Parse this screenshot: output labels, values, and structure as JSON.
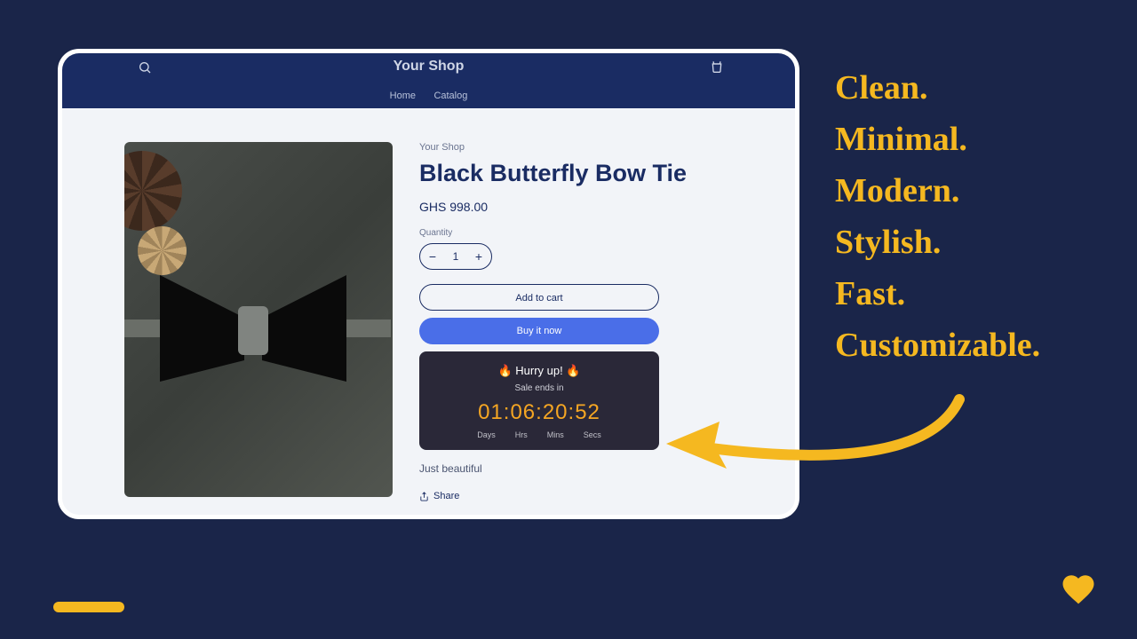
{
  "shop": {
    "title": "Your Shop",
    "nav": {
      "home": "Home",
      "catalog": "Catalog"
    }
  },
  "product": {
    "vendor": "Your Shop",
    "title": "Black Butterfly Bow Tie",
    "price": "GHS 998.00",
    "quantity_label": "Quantity",
    "quantity_value": "1",
    "add_to_cart": "Add to cart",
    "buy_now": "Buy it now",
    "description": "Just beautiful",
    "share_label": "Share"
  },
  "countdown": {
    "headline": "🔥 Hurry up! 🔥",
    "subtext": "Sale ends in",
    "days": "01",
    "hrs": "06",
    "mins": "20",
    "secs": "52",
    "label_days": "Days",
    "label_hrs": "Hrs",
    "label_mins": "Mins",
    "label_secs": "Secs"
  },
  "features": {
    "f1": "Clean.",
    "f2": "Minimal.",
    "f3": "Modern.",
    "f4": "Stylish.",
    "f5": "Fast.",
    "f6": "Customizable."
  }
}
